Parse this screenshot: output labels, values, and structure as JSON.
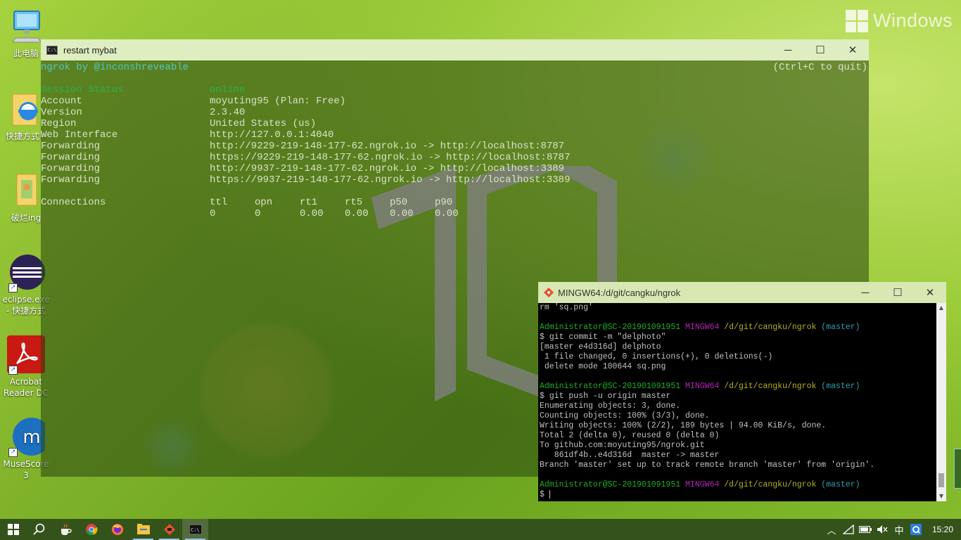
{
  "desktop": {
    "watermark": "Windows",
    "icons": [
      {
        "label": "此电脑"
      },
      {
        "label": "快捷方式+"
      },
      {
        "label": "破烂ing"
      },
      {
        "label": "eclipse.exe - 快捷方式"
      },
      {
        "label": "Acrobat Reader DC"
      },
      {
        "label": "MuseScore 3"
      }
    ]
  },
  "ngrok_window": {
    "title": "restart mybat",
    "header_left": "ngrok by @inconshreveable",
    "header_right": "(Ctrl+C to quit)",
    "rows": [
      {
        "label": "Session Status",
        "value": "online"
      },
      {
        "label": "Account",
        "value": "moyuting95 (Plan: Free)"
      },
      {
        "label": "Version",
        "value": "2.3.40"
      },
      {
        "label": "Region",
        "value": "United States (us)"
      },
      {
        "label": "Web Interface",
        "value": "http://127.0.0.1:4040"
      },
      {
        "label": "Forwarding",
        "value": "http://9229-219-148-177-62.ngrok.io -> http://localhost:8787"
      },
      {
        "label": "Forwarding",
        "value": "https://9229-219-148-177-62.ngrok.io -> http://localhost:8787"
      },
      {
        "label": "Forwarding",
        "value": "http://9937-219-148-177-62.ngrok.io -> http://localhost:3389"
      },
      {
        "label": "Forwarding",
        "value": "https://9937-219-148-177-62.ngrok.io -> http://localhost:3389"
      }
    ],
    "connections": {
      "label": "Connections",
      "headers": [
        "ttl",
        "opn",
        "rt1",
        "rt5",
        "p50",
        "p90"
      ],
      "values": [
        "0",
        "0",
        "0.00",
        "0.00",
        "0.00",
        "0.00"
      ]
    }
  },
  "git_window": {
    "title": "MINGW64:/d/git/cangku/ngrok",
    "lines": [
      {
        "type": "plain",
        "text": "rm 'sq.png'"
      },
      {
        "type": "blank",
        "text": ""
      },
      {
        "type": "prompt",
        "user": "Administrator@SC-201901091951",
        "env": "MINGW64",
        "path": "/d/git/cangku/ngrok",
        "branch": "(master)"
      },
      {
        "type": "plain",
        "text": "$ git commit -m \"delphoto\""
      },
      {
        "type": "plain",
        "text": "[master e4d316d] delphoto"
      },
      {
        "type": "plain",
        "text": " 1 file changed, 0 insertions(+), 0 deletions(-)"
      },
      {
        "type": "plain",
        "text": " delete mode 100644 sq.png"
      },
      {
        "type": "blank",
        "text": ""
      },
      {
        "type": "prompt",
        "user": "Administrator@SC-201901091951",
        "env": "MINGW64",
        "path": "/d/git/cangku/ngrok",
        "branch": "(master)"
      },
      {
        "type": "plain",
        "text": "$ git push -u origin master"
      },
      {
        "type": "plain",
        "text": "Enumerating objects: 3, done."
      },
      {
        "type": "plain",
        "text": "Counting objects: 100% (3/3), done."
      },
      {
        "type": "plain",
        "text": "Writing objects: 100% (2/2), 189 bytes | 94.00 KiB/s, done."
      },
      {
        "type": "plain",
        "text": "Total 2 (delta 0), reused 0 (delta 0)"
      },
      {
        "type": "plain",
        "text": "To github.com:moyuting95/ngrok.git"
      },
      {
        "type": "plain",
        "text": "   861df4b..e4d316d  master -> master"
      },
      {
        "type": "plain",
        "text": "Branch 'master' set up to track remote branch 'master' from 'origin'."
      },
      {
        "type": "blank",
        "text": ""
      },
      {
        "type": "prompt",
        "user": "Administrator@SC-201901091951",
        "env": "MINGW64",
        "path": "/d/git/cangku/ngrok",
        "branch": "(master)"
      },
      {
        "type": "plain",
        "text": "$ "
      }
    ]
  },
  "taskbar": {
    "time": "15:20",
    "ime": "中",
    "apps": [
      "start-button",
      "search-icon",
      "java-icon",
      "chrome-icon",
      "firefox-icon",
      "file-explorer-icon",
      "git-icon",
      "cmd-icon"
    ]
  },
  "colors": {
    "desktop_green": "#7fb22a",
    "terminal_cyan": "#4fc7c7",
    "status_green": "#2bb04a",
    "git_prompt_green": "#1fb022",
    "git_prompt_magenta": "#b123b6",
    "git_path_yellow": "#b7b11e",
    "git_branch_cyan": "#2aa0b0"
  }
}
